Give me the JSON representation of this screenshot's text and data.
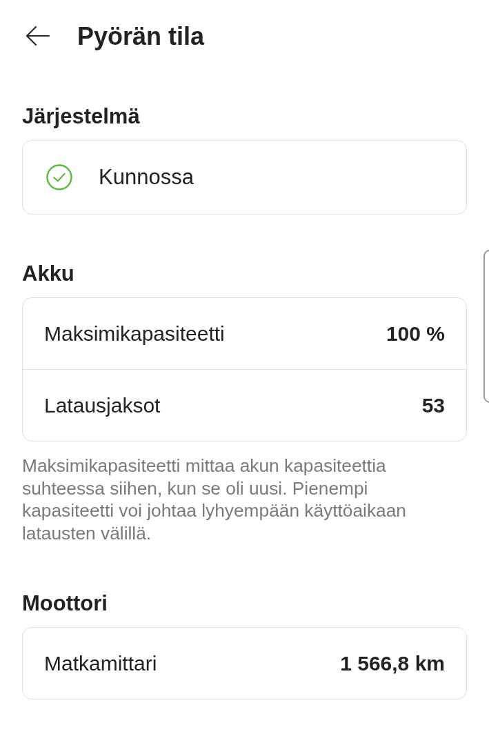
{
  "header": {
    "title": "Pyörän tila"
  },
  "sections": [
    {
      "kind": "status",
      "heading": "Järjestelmä",
      "status": {
        "label": "Kunnossa"
      }
    },
    {
      "kind": "table",
      "heading": "Akku",
      "rows": [
        {
          "label": "Maksimikapasiteetti",
          "value": "100 %"
        },
        {
          "label": "Latausjaksot",
          "value": "53"
        }
      ],
      "note": "Maksimikapasiteetti mittaa akun kapasiteettia suhteessa siihen, kun se oli uusi. Pienempi kapasiteetti voi johtaa lyhyempään käyttöaikaan latausten välillä."
    },
    {
      "kind": "table",
      "heading": "Moottori",
      "rows": [
        {
          "label": "Matkamittari",
          "value": "1 566,8 km"
        }
      ]
    }
  ]
}
